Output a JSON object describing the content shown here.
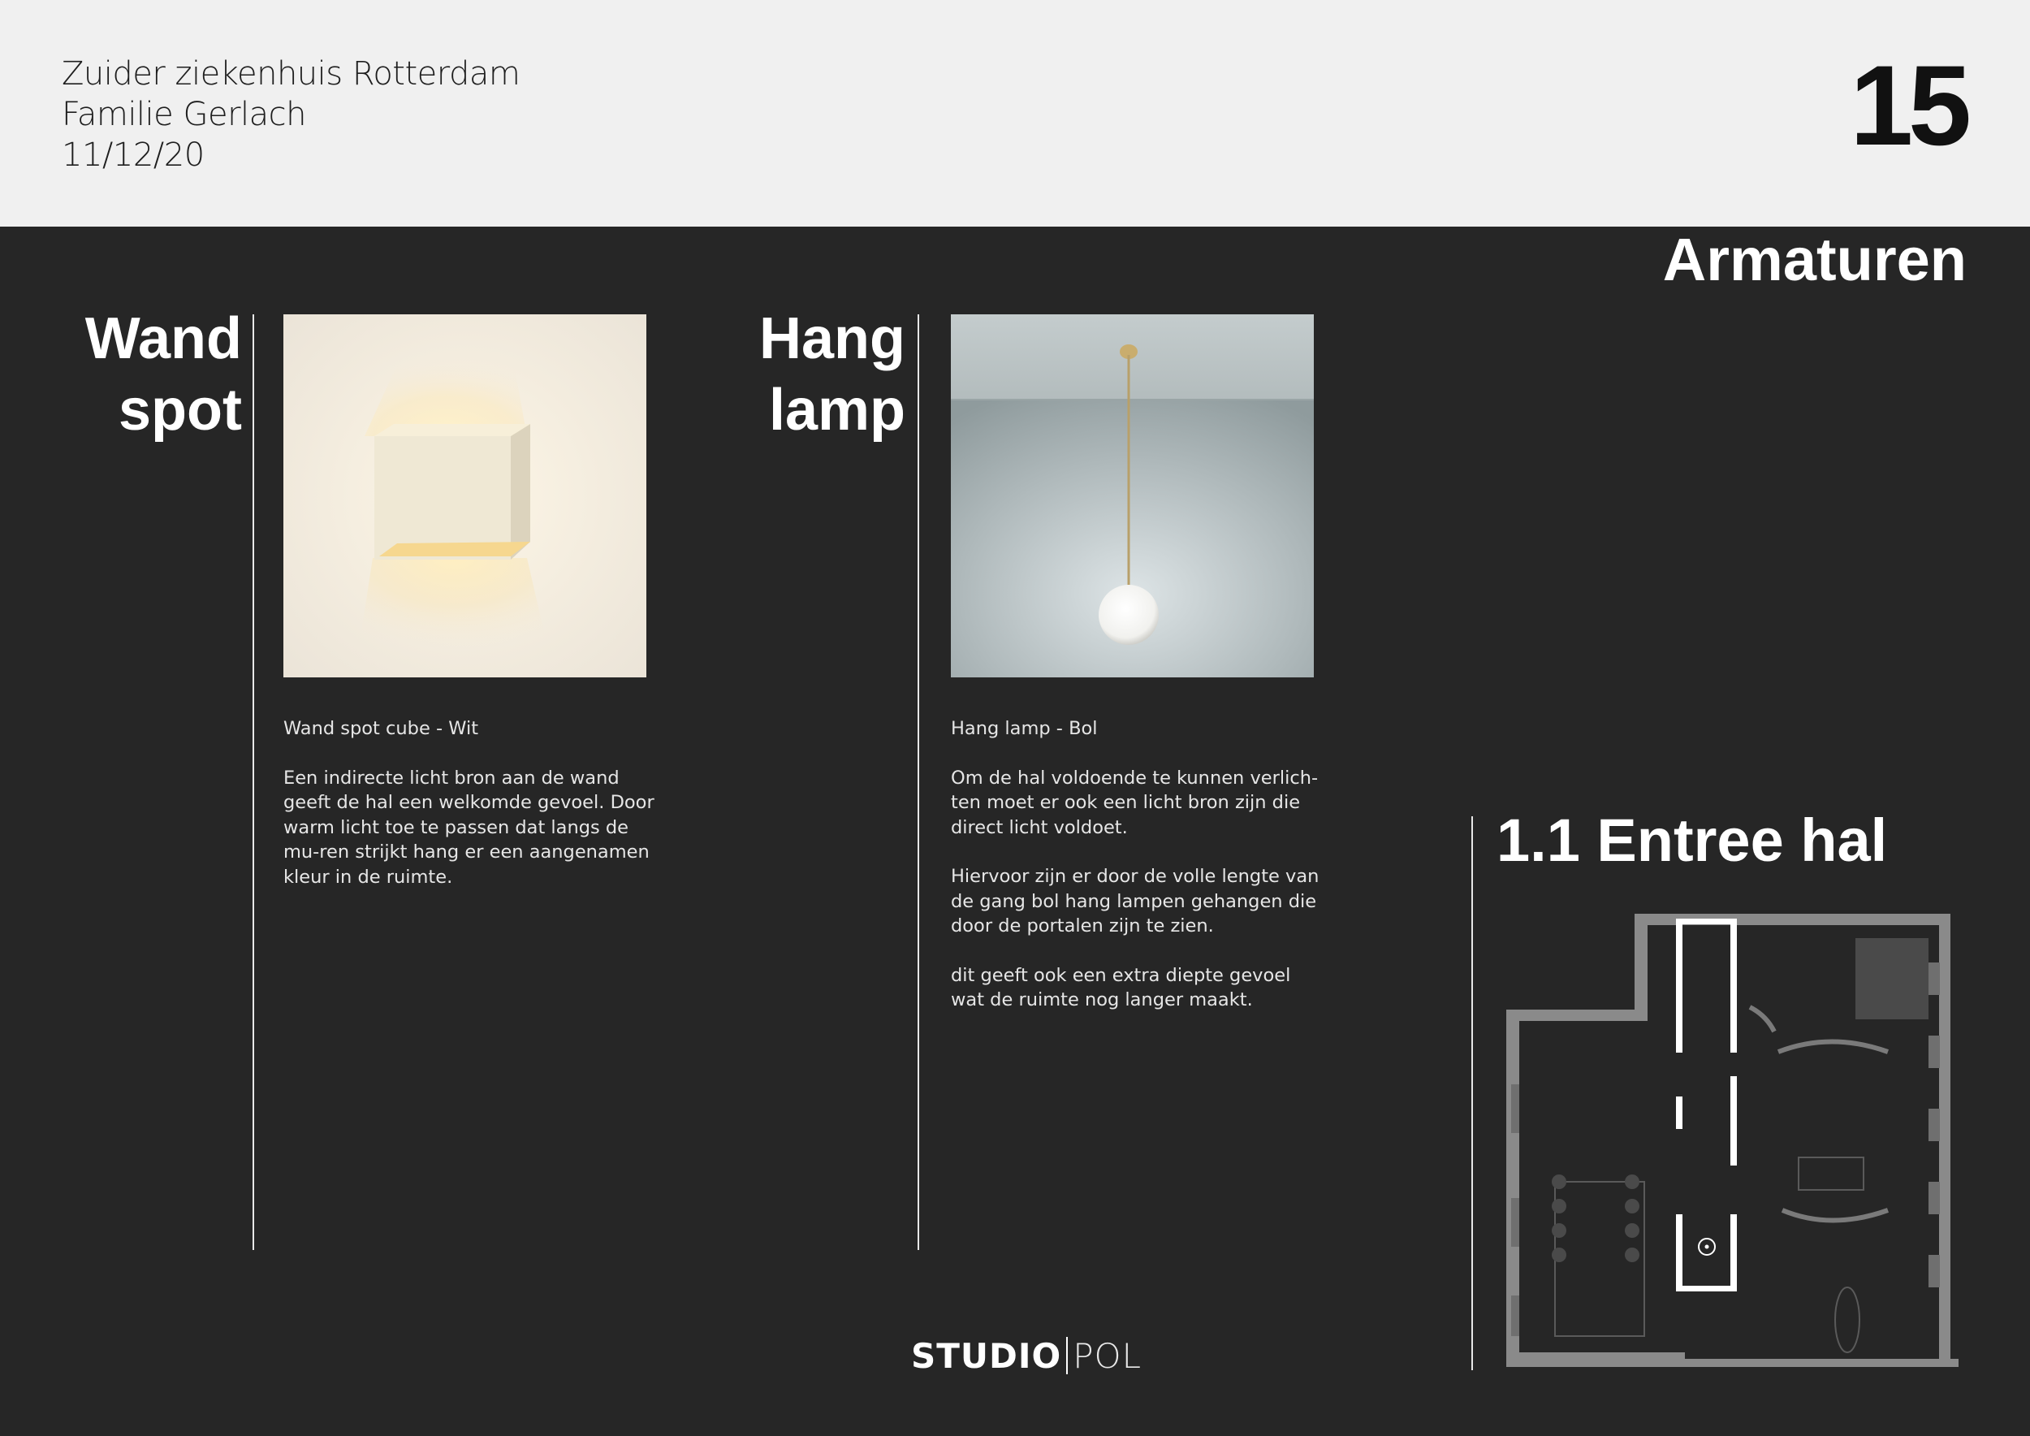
{
  "header": {
    "project": "Zuider ziekenhuis Rotterdam",
    "client": "Familie Gerlach",
    "date": "11/12/20",
    "page_number": "15"
  },
  "section_title": "Armaturen",
  "wandspot": {
    "heading_line1": "Wand",
    "heading_line2": "spot",
    "caption_title": "Wand spot cube - Wit",
    "paragraphs": [
      "Een indirecte licht bron aan de wand geeft de hal een welkomde gevoel. Door warm licht toe te passen dat langs de mu-ren strijkt hang er een aangenamen kleur in de ruimte."
    ]
  },
  "hanglamp": {
    "heading_line1": "Hang",
    "heading_line2": "lamp",
    "caption_title": "Hang lamp - Bol",
    "paragraphs": [
      "Om de hal voldoende te kunnen verlich-ten moet er ook een licht bron zijn die direct licht voldoet.",
      "Hiervoor zijn er door de volle lengte van de gang bol hang lampen gehangen die door de portalen zijn te zien.",
      "dit geeft ook een extra diepte gevoel wat de ruimte nog langer maakt."
    ]
  },
  "room": {
    "title": "1.1 Entree hal"
  },
  "logo": {
    "bold": "STUDIO",
    "light": "POL"
  },
  "colors": {
    "background": "#262626",
    "header": "#f0f0f0",
    "text": "#ffffff"
  }
}
